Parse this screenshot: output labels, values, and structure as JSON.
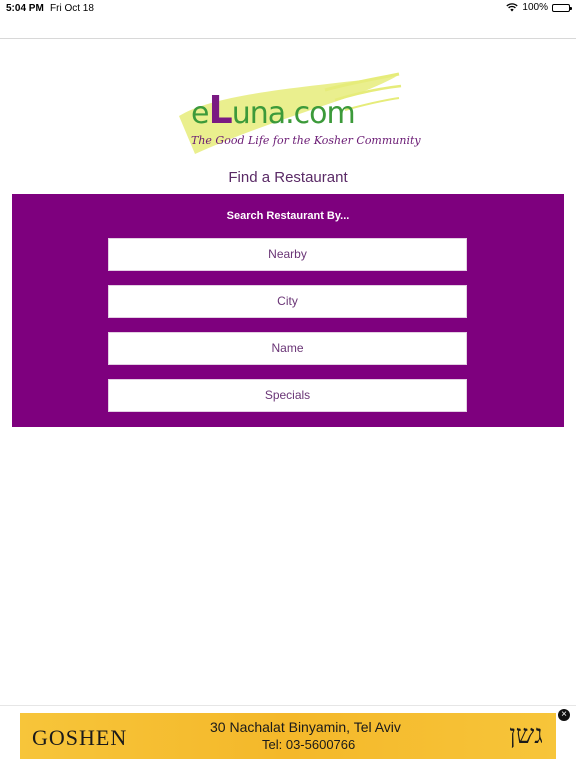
{
  "status_bar": {
    "time": "5:04 PM",
    "date": "Fri Oct 18",
    "battery": "100%"
  },
  "logo": {
    "word_prefix": "e",
    "word_letter": "L",
    "word_suffix": "una.com",
    "tagline": "The Good Life for the Kosher Community"
  },
  "page": {
    "title": "Find a Restaurant"
  },
  "search_panel": {
    "heading": "Search Restaurant By...",
    "options": [
      "Nearby",
      "City",
      "Name",
      "Specials"
    ]
  },
  "ad": {
    "brand": "GOSHEN",
    "address": "30 Nachalat Binyamin, Tel Aviv",
    "phone": "Tel: 03-5600766",
    "emblem": "גשן",
    "close_glyph": "×"
  },
  "colors": {
    "panel": "#7e007e",
    "logo_green": "#3c9a3a",
    "logo_purple": "#7a1a82",
    "ad_yellow": "#f7c53a"
  }
}
